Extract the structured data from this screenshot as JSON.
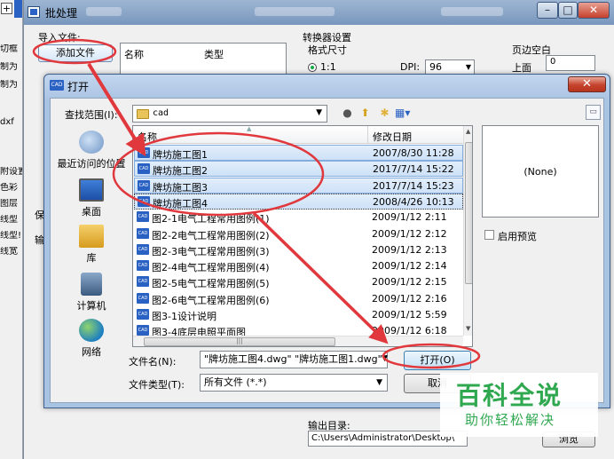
{
  "background_app": {
    "left_items": [
      "切框",
      "制为",
      "制为",
      "dxf",
      "附设置",
      "色彩",
      "图层",
      "线型",
      "线型!",
      "线宽"
    ],
    "window_title": "批处理",
    "import_label": "导入文件:",
    "add_file_label": "添加文件",
    "list_headers": {
      "name": "名称",
      "type": "类型"
    },
    "converter_title": "转换器设置",
    "format_size_label": "格式尺寸",
    "scale_value": "1:1",
    "dpi_label": "DPI:",
    "dpi_value": "96",
    "page_margin_label": "页边空白",
    "top_label": "上面",
    "top_value": "0",
    "output_dir_label": "输出目录:",
    "output_dir_value": "C:\\Users\\Administrator\\Desktop\\",
    "browse_label": "浏览",
    "side_letters": [
      "保",
      "输"
    ]
  },
  "open_dialog": {
    "title": "打开",
    "look_in_label": "查找范围(I):",
    "look_in_value": "cad",
    "places": [
      {
        "label": "最近访问的位置",
        "icon": "recent-places-icon"
      },
      {
        "label": "桌面",
        "icon": "desktop-icon"
      },
      {
        "label": "库",
        "icon": "library-icon"
      },
      {
        "label": "计算机",
        "icon": "computer-icon"
      },
      {
        "label": "网络",
        "icon": "network-icon"
      }
    ],
    "columns": {
      "name": "名称",
      "modified": "修改日期"
    },
    "files": [
      {
        "name": "牌坊施工图1",
        "date": "2007/8/30 11:28",
        "selected": true
      },
      {
        "name": "牌坊施工图2",
        "date": "2017/7/14 15:22",
        "selected": true
      },
      {
        "name": "牌坊施工图3",
        "date": "2017/7/14 15:23",
        "selected": true
      },
      {
        "name": "牌坊施工图4",
        "date": "2008/4/26 10:13",
        "selected": true
      },
      {
        "name": "图2-1电气工程常用图例(1)",
        "date": "2009/1/12 2:11",
        "selected": false
      },
      {
        "name": "图2-2电气工程常用图例(2)",
        "date": "2009/1/12 2:12",
        "selected": false
      },
      {
        "name": "图2-3电气工程常用图例(3)",
        "date": "2009/1/12 2:13",
        "selected": false
      },
      {
        "name": "图2-4电气工程常用图例(4)",
        "date": "2009/1/12 2:14",
        "selected": false
      },
      {
        "name": "图2-5电气工程常用图例(5)",
        "date": "2009/1/12 2:15",
        "selected": false
      },
      {
        "name": "图2-6电气工程常用图例(6)",
        "date": "2009/1/12 2:16",
        "selected": false
      },
      {
        "name": "图3-1设计说明",
        "date": "2009/1/12 5:59",
        "selected": false
      },
      {
        "name": "图3-4底层电照平面图",
        "date": "2009/1/12 6:18",
        "selected": false
      }
    ],
    "file_icon_text": "CAD",
    "preview_text": "(None)",
    "enable_preview_label": "启用预览",
    "file_name_label": "文件名(N):",
    "file_name_value": "\"牌坊施工图4.dwg\" \"牌坊施工图1.dwg\" \"",
    "file_type_label": "文件类型(T):",
    "file_type_value": "所有文件 (*.*)",
    "open_label": "打开(O)",
    "cancel_label": "取消"
  },
  "watermark": {
    "title": "百科全说",
    "subtitle": "助你轻松解决"
  },
  "colors": {
    "annotation_red": "#e0383c",
    "selection_blue": "#cde1f7",
    "watermark_green": "#2fa84f"
  }
}
